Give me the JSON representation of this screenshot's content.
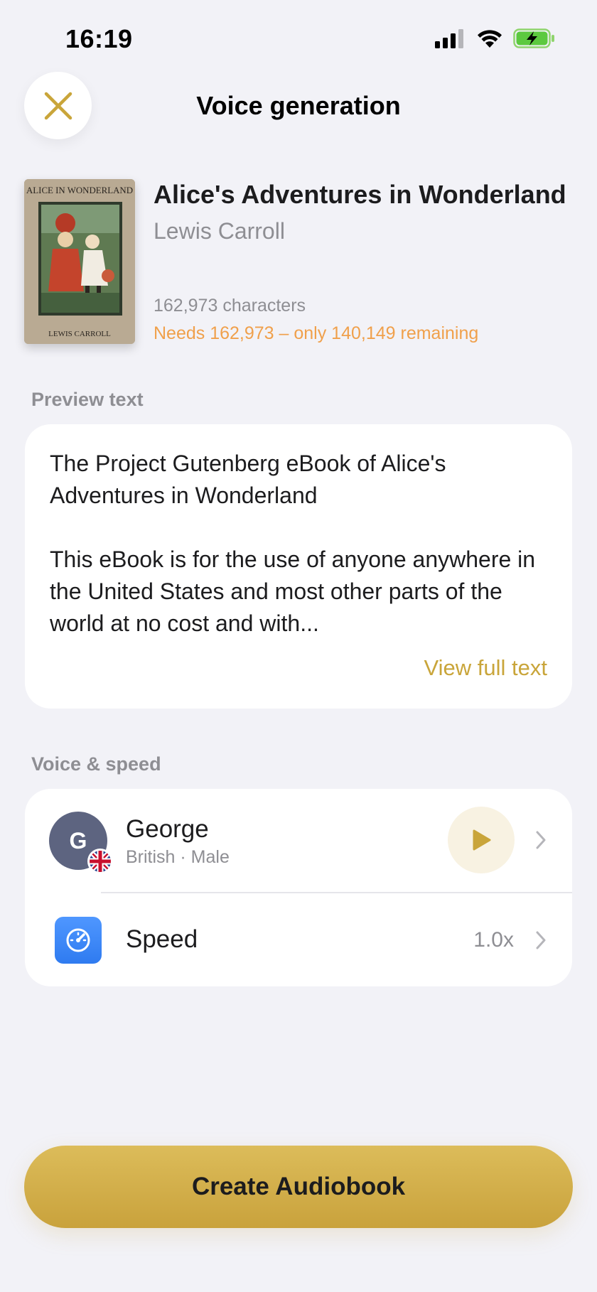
{
  "status_bar": {
    "time": "16:19"
  },
  "header": {
    "title": "Voice generation"
  },
  "book": {
    "cover_title": "ALICE IN WONDERLAND",
    "cover_author": "LEWIS CARROLL",
    "title": "Alice's Adventures in Wonderland",
    "author": "Lewis Carroll",
    "characters": "162,973 characters",
    "warning": "Needs 162,973 – only 140,149 remaining"
  },
  "preview": {
    "label": "Preview text",
    "paragraph1": "The Project Gutenberg eBook of Alice's Adventures in Wonderland",
    "paragraph2": "This eBook is for the use of anyone anywhere in the United States and most other parts of the world at no cost and with...",
    "view_full": "View full text"
  },
  "voice_section": {
    "label": "Voice & speed",
    "voice": {
      "initial": "G",
      "name": "George",
      "description": "British · Male"
    },
    "speed": {
      "label": "Speed",
      "value": "1.0x"
    }
  },
  "cta": {
    "label": "Create Audiobook"
  },
  "colors": {
    "accent": "#c9a53a",
    "warning": "#f0a04b",
    "background": "#f2f2f7",
    "speed_icon": "#3a86f5",
    "avatar": "#5d6480"
  }
}
